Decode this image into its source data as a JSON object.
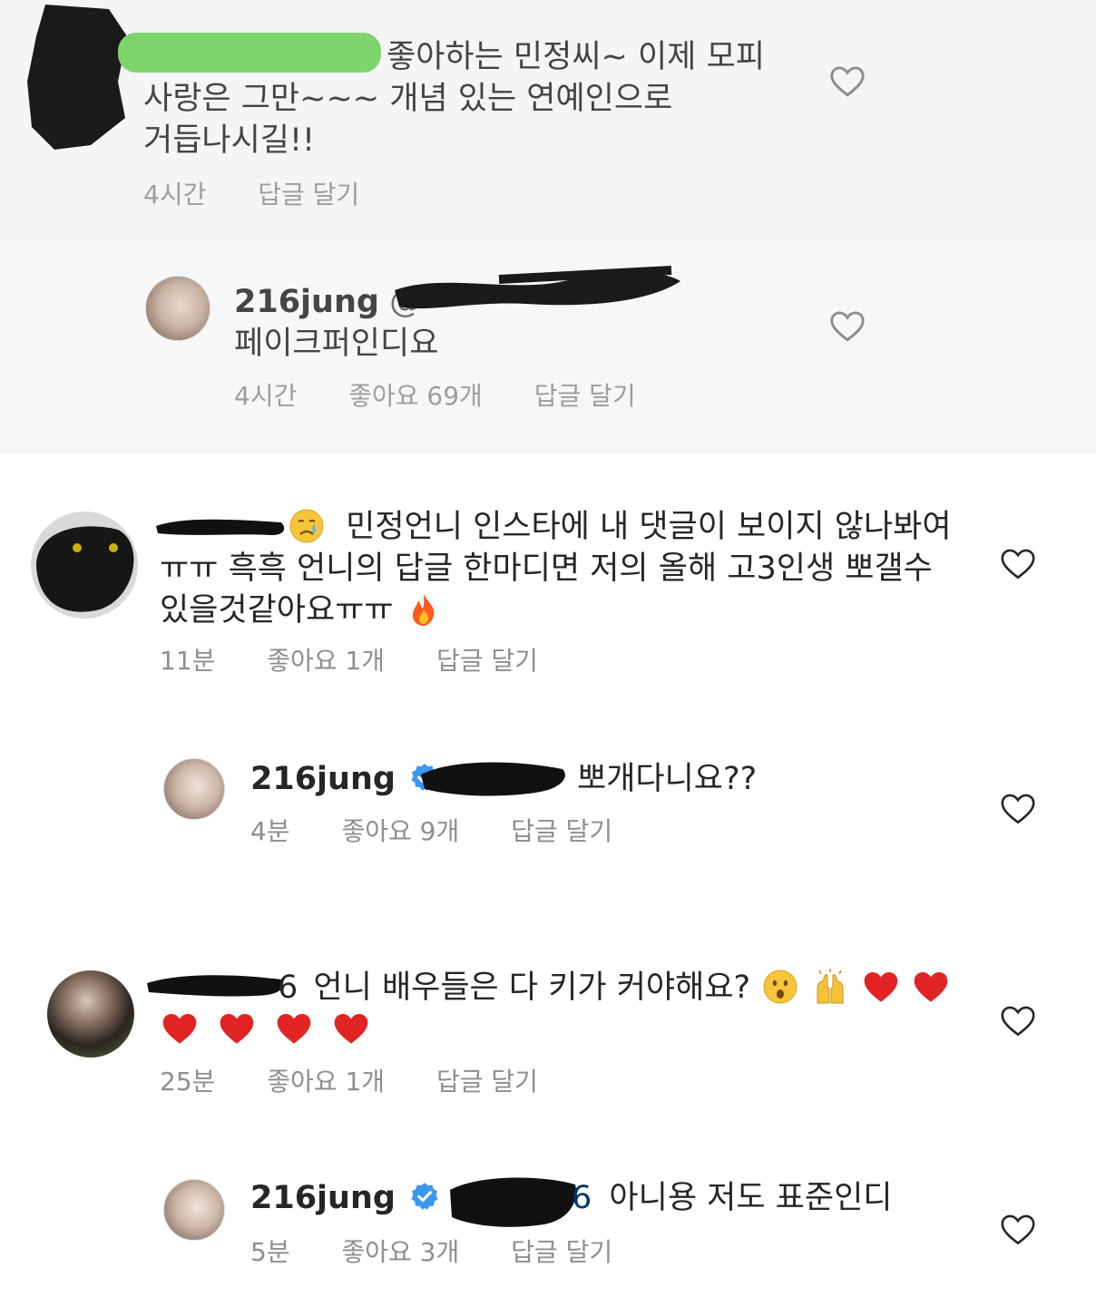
{
  "comments": [
    {
      "text": "좋아하는 민정씨~ 이제 모피",
      "text_line2": "사랑은 그만~~~ 개념 있는 연예인으로",
      "text_line3": "거듭나시길!!",
      "time": "4시간",
      "reply_label": "답글 달기"
    },
    {
      "username": "216jung",
      "mention": "@",
      "text": "페이크퍼인디요",
      "time": "4시간",
      "likes": "좋아요 69개",
      "reply_label": "답글 달기"
    },
    {
      "text_line1": "민정언니 인스타에 내 댓글이 보이지 않나봐여",
      "text_line2": "ㅠㅠ 흑흑 언니의 답글 한마디면 저의 올해 고3인생 뽀갤수",
      "text_line3": "있을것같아요ㅠㅠ",
      "time": "11분",
      "likes": "좋아요 1개",
      "reply_label": "답글 달기"
    },
    {
      "username": "216jung",
      "text": "뽀개다니요??",
      "time": "4분",
      "likes": "좋아요 9개",
      "reply_label": "답글 달기"
    },
    {
      "prefix": "6",
      "text_line1": "언니 배우들은 다 키가 커야해요?",
      "time": "25분",
      "likes": "좋아요 1개",
      "reply_label": "답글 달기"
    },
    {
      "username": "216jung",
      "mention": "@",
      "mention_suffix": "6",
      "text": "아니용 저도 표준인디",
      "time": "5분",
      "likes": "좋아요 3개",
      "reply_label": "답글 달기"
    }
  ],
  "icons": {
    "heart": "heart-outline-icon",
    "verified": "verified-badge-icon"
  },
  "colors": {
    "text": "#262626",
    "meta": "#8e8e8e",
    "verified": "#3897f0",
    "green_highlight": "#7ed36b"
  }
}
